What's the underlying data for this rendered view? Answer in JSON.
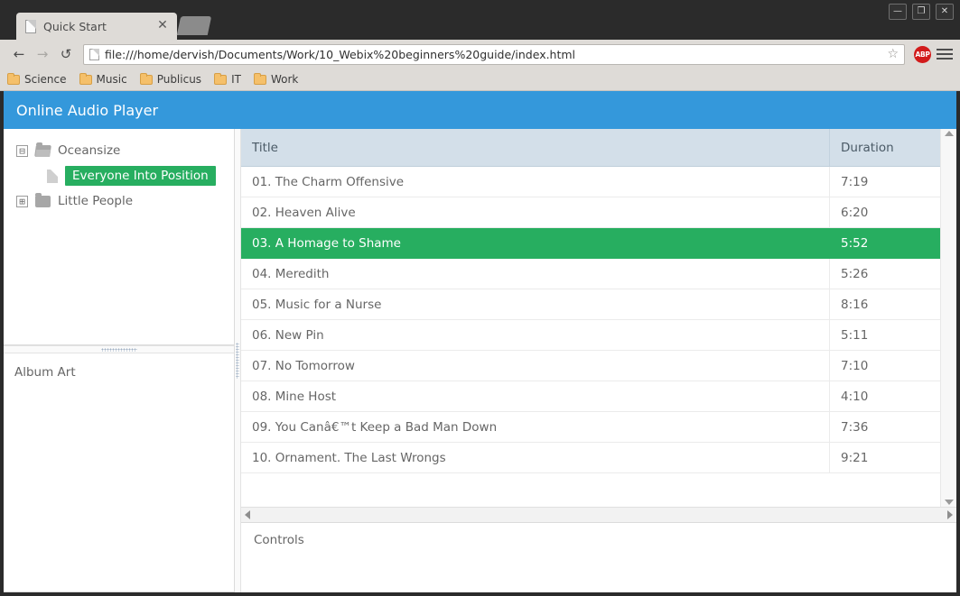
{
  "browser": {
    "tab": {
      "title": "Quick Start",
      "favicon_icon": "page-icon",
      "close_icon": "✕"
    },
    "new_tab_label": "",
    "window_buttons": {
      "minimize": "—",
      "maximize": "❐",
      "close": "✕"
    },
    "nav": {
      "back_icon": "←",
      "forward_icon": "→",
      "reload_icon": "↺"
    },
    "url": "file:///home/dervish/Documents/Work/10_Webix%20beginners%20guide/index.html",
    "star_icon": "☆",
    "extension_badge": "ABP",
    "menu_icon": "hamburger-icon",
    "bookmarks": [
      {
        "label": "Science"
      },
      {
        "label": "Music"
      },
      {
        "label": "Publicus"
      },
      {
        "label": "IT"
      },
      {
        "label": "Work"
      }
    ]
  },
  "app": {
    "header_title": "Online Audio Player",
    "accent_blue": "#3498db",
    "accent_green": "#27ae60",
    "grid_header_bg": "#d3dfe9",
    "tree": [
      {
        "label": "Oceansize",
        "toggle": "⊟",
        "icon": "folder-open-icon",
        "selected": false,
        "indent": false
      },
      {
        "label": "Everyone Into Position",
        "toggle": "",
        "icon": "document-icon",
        "selected": true,
        "indent": true
      },
      {
        "label": "Little People",
        "toggle": "⊞",
        "icon": "folder-closed-icon",
        "selected": false,
        "indent": false
      }
    ],
    "album_art_label": "Album Art",
    "controls_label": "Controls",
    "grid": {
      "columns": [
        {
          "key": "title",
          "label": "Title"
        },
        {
          "key": "duration",
          "label": "Duration"
        }
      ],
      "rows": [
        {
          "title": "01. The Charm Offensive",
          "duration": "7:19",
          "selected": false
        },
        {
          "title": "02. Heaven Alive",
          "duration": "6:20",
          "selected": false
        },
        {
          "title": "03. A Homage to Shame",
          "duration": "5:52",
          "selected": true
        },
        {
          "title": "04. Meredith",
          "duration": "5:26",
          "selected": false
        },
        {
          "title": "05. Music for a Nurse",
          "duration": "8:16",
          "selected": false
        },
        {
          "title": "06. New Pin",
          "duration": "5:11",
          "selected": false
        },
        {
          "title": "07. No Tomorrow",
          "duration": "7:10",
          "selected": false
        },
        {
          "title": "08. Mine Host",
          "duration": "4:10",
          "selected": false
        },
        {
          "title": "09. You Canâ€™t Keep a Bad Man Down",
          "duration": "7:36",
          "selected": false
        },
        {
          "title": "10. Ornament. The Last Wrongs",
          "duration": "9:21",
          "selected": false
        }
      ]
    }
  }
}
